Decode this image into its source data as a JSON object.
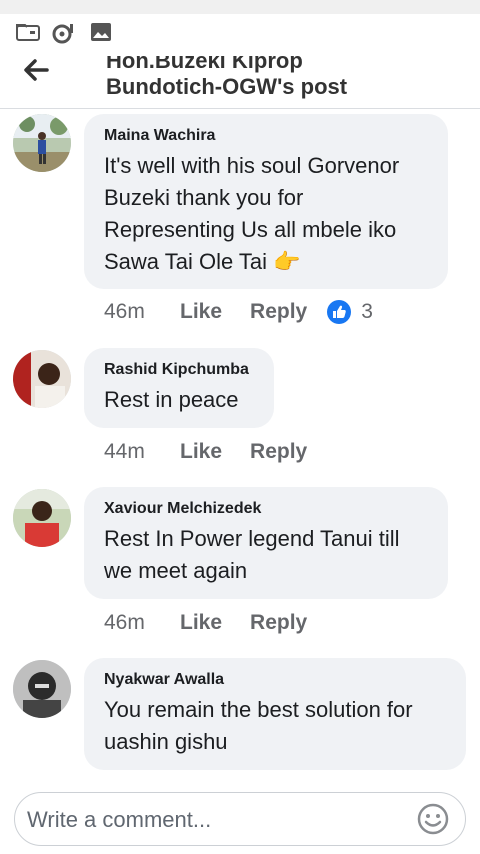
{
  "header": {
    "title_line1": "Hon.Buzeki Kiprop",
    "title_line2": "Bundotich-OGW's post"
  },
  "comments": [
    {
      "author": "Maina Wachira",
      "text_lines": [
        "It's well with his soul Gorvenor",
        "Buzeki thank you for",
        "Representing Us all mbele iko",
        "Sawa Tai Ole Tai 👉"
      ],
      "time": "46m",
      "like": "Like",
      "reply": "Reply",
      "reaction_count": "3"
    },
    {
      "author": "Rashid Kipchumba",
      "text_lines": [
        "Rest in peace"
      ],
      "time": "44m",
      "like": "Like",
      "reply": "Reply"
    },
    {
      "author": "Xaviour Melchizedek",
      "text_lines": [
        "Rest In Power legend Tanui till",
        "we meet again"
      ],
      "time": "46m",
      "like": "Like",
      "reply": "Reply"
    },
    {
      "author": "Nyakwar Awalla",
      "text_lines": [
        "You remain the best solution for",
        "uashin gishu"
      ]
    }
  ],
  "composer": {
    "placeholder": "Write a comment..."
  },
  "colors": {
    "like_blue": "#1877f2",
    "bubble_bg": "#f0f2f5",
    "meta_gray": "#65676b"
  }
}
